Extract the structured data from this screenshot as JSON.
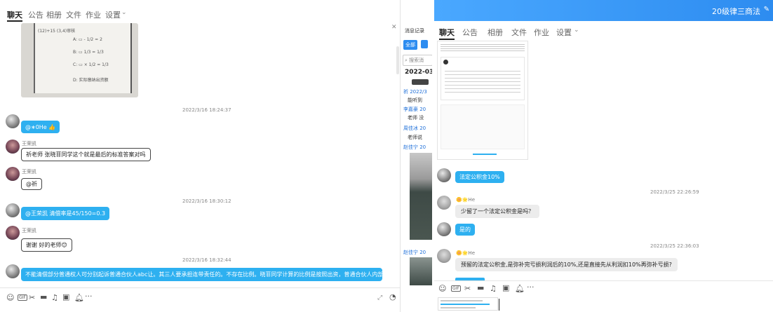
{
  "left": {
    "tabs": [
      "聊天",
      "公告",
      "相册",
      "文件",
      "作业",
      "设置"
    ],
    "dropdown_icon": "chevron-down-icon",
    "photo_lines": [
      "(12)+15 (3,4)审核",
      "A: ▭ - 1/2 = 2",
      "B: ▭ 1/3 = 1/3",
      "C: ▭ × 1/2 = 1/3",
      "D: 实际缴纳出资额"
    ],
    "messages": [
      {
        "time": "2022/3/16 18:24:37"
      },
      {
        "text": "@∗0He 👍"
      },
      {
        "name": "王荣凯",
        "text": "祈老师 张晓菲同学这个就是最后的标准答案对吗"
      },
      {
        "name": "王荣凯",
        "text": "@祈"
      },
      {
        "time": "2022/3/16 18:30:12"
      },
      {
        "text": "@王荣凯 清偿率是45/150=0.3"
      },
      {
        "name": "王荣凯",
        "text": "谢谢 好的老师😊"
      },
      {
        "time": "2022/3/16 18:32:44"
      },
      {
        "text": "不能清偿部分普通权人可分别起诉普通合伙人abc让。其三人要承担连带责任的。不存在比例。晓菲同学计算的比例是按照出资，普通合伙人内部各自应承担的份额。"
      }
    ],
    "toolbar_icons": [
      "emoji-icon",
      "gif-icon",
      "scissors-icon",
      "folder-icon",
      "music-icon",
      "image-icon",
      "bell-icon",
      "more-icon"
    ],
    "more_label": "···"
  },
  "history": {
    "title": "消息记录",
    "filter_all": "全部",
    "search_placeholder": "搜索消",
    "date": "2022-03",
    "entries": [
      {
        "who": "祈 2022/3",
        "text": "能听到"
      },
      {
        "who": "李嘉豪 20",
        "text": "老师 没"
      },
      {
        "who": "周佳冰 20",
        "text": "老师说"
      },
      {
        "who": "赵佳宁 20",
        "text": ""
      },
      {
        "who": "赵佳宁 20",
        "text": ""
      }
    ]
  },
  "right": {
    "header_title": "20级律三商法",
    "header_color": "#2d8cf0",
    "tabs": [
      "聊天",
      "公告",
      "相册",
      "文件",
      "作业",
      "设置"
    ],
    "messages": [
      {
        "text": "法定公积金10%"
      },
      {
        "time": "2022/3/25 22:26:59"
      },
      {
        "name": "🌼🌟He",
        "text": "少留了一个法定公积金是吗？"
      },
      {
        "text": "是的"
      },
      {
        "time": "2022/3/25 22:36:03"
      },
      {
        "name": "🌼🌟He",
        "text": "预留的法定公积金,是弥补完亏损利润后的10%,还是直接先从利润扣10%再弥补亏损?"
      }
    ],
    "more_label": "···"
  }
}
